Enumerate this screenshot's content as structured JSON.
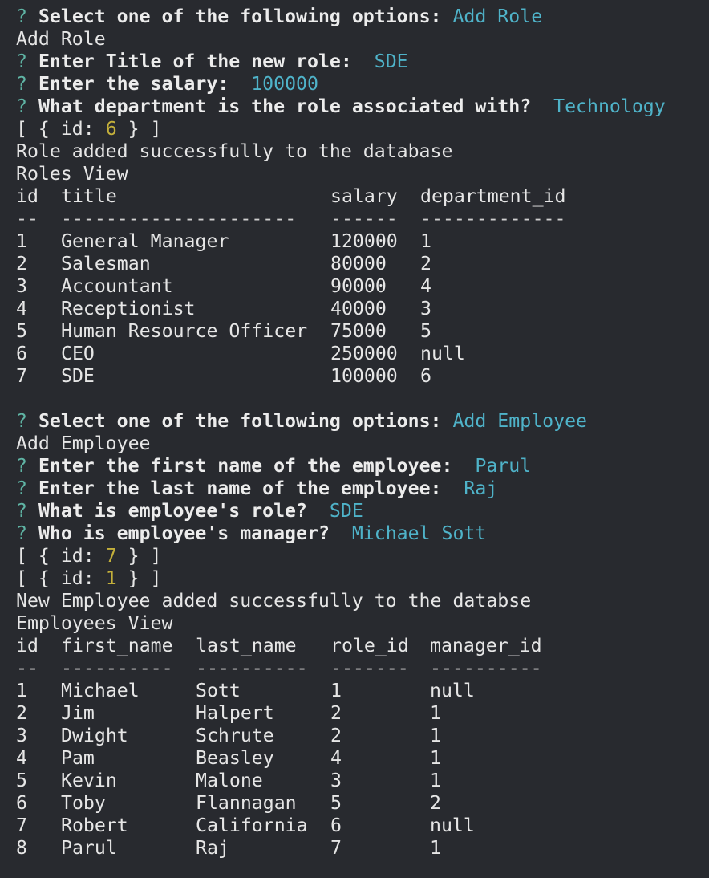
{
  "colors": {
    "background": "#282a2f",
    "text": "#e6e6e6",
    "prompt_mark": "#5fb4a4",
    "answer": "#4fb3c9",
    "number": "#c4b03b"
  },
  "role_session": {
    "q_mark": "?",
    "menu_prompt": "Select one of the following options:",
    "menu_answer": "Add Role",
    "echo": "Add Role",
    "title_prompt": "Enter Title of the new role:",
    "title_answer": "SDE",
    "salary_prompt": "Enter the salary:",
    "salary_answer": "100000",
    "dept_prompt": "What department is the role associated with?",
    "dept_answer": "Technology",
    "id_result": {
      "open": "[ { id: ",
      "value": "6",
      "close": " } ]"
    },
    "success": "Role added successfully to the database",
    "view_title": "Roles View",
    "headers": [
      "id",
      "title",
      "salary",
      "department_id"
    ],
    "dashes": [
      "--",
      "---------------------",
      "------",
      "-------------"
    ],
    "rows": [
      [
        "1",
        "General Manager",
        "120000",
        "1"
      ],
      [
        "2",
        "Salesman",
        "80000",
        "2"
      ],
      [
        "3",
        "Accountant",
        "90000",
        "4"
      ],
      [
        "4",
        "Receptionist",
        "40000",
        "3"
      ],
      [
        "5",
        "Human Resource Officer",
        "75000",
        "5"
      ],
      [
        "6",
        "CEO",
        "250000",
        "null"
      ],
      [
        "7",
        "SDE",
        "100000",
        "6"
      ]
    ]
  },
  "employee_session": {
    "q_mark": "?",
    "menu_prompt": "Select one of the following options:",
    "menu_answer": "Add Employee",
    "echo": "Add Employee",
    "first_prompt": "Enter the first name of the employee:",
    "first_answer": "Parul",
    "last_prompt": "Enter the last name of the employee:",
    "last_answer": "Raj",
    "role_prompt": "What is employee's role?",
    "role_answer": "SDE",
    "manager_prompt": "Who is employee's manager?",
    "manager_answer": "Michael Sott",
    "id_results": [
      {
        "open": "[ { id: ",
        "value": "7",
        "close": " } ]"
      },
      {
        "open": "[ { id: ",
        "value": "1",
        "close": " } ]"
      }
    ],
    "success": "New Employee added successfully to the databse",
    "view_title": "Employees View",
    "headers": [
      "id",
      "first_name",
      "last_name",
      "role_id",
      "manager_id"
    ],
    "dashes": [
      "--",
      "----------",
      "----------",
      "-------",
      "----------"
    ],
    "rows": [
      [
        "1",
        "Michael",
        "Sott",
        "1",
        "null"
      ],
      [
        "2",
        "Jim",
        "Halpert",
        "2",
        "1"
      ],
      [
        "3",
        "Dwight",
        "Schrute",
        "2",
        "1"
      ],
      [
        "4",
        "Pam",
        "Beasley",
        "4",
        "1"
      ],
      [
        "5",
        "Kevin",
        "Malone",
        "3",
        "1"
      ],
      [
        "6",
        "Toby",
        "Flannagan",
        "5",
        "2"
      ],
      [
        "7",
        "Robert",
        "California",
        "6",
        "null"
      ],
      [
        "8",
        "Parul",
        "Raj",
        "7",
        "1"
      ]
    ]
  }
}
